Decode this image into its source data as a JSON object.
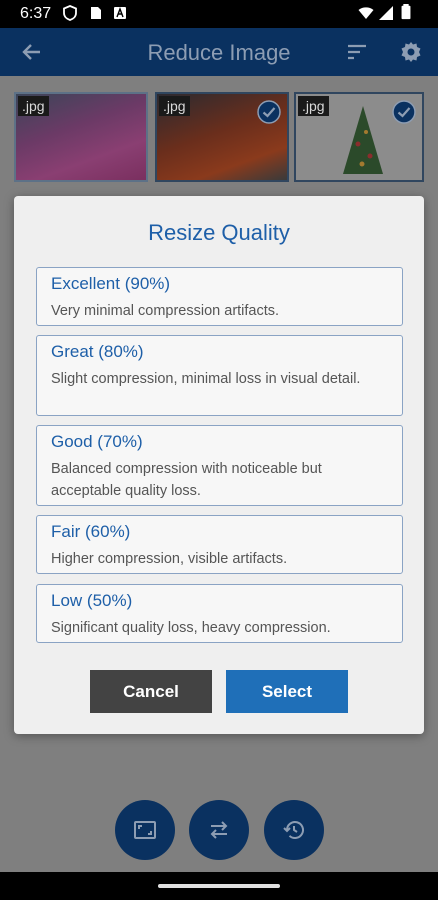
{
  "status_bar": {
    "time": "6:37"
  },
  "app_bar": {
    "title": "Reduce Image",
    "icons": [
      "back-arrow-icon",
      "sort-icon",
      "settings-icon"
    ]
  },
  "thumbnails": [
    {
      "ext": ".jpg",
      "selected": false
    },
    {
      "ext": ".jpg",
      "selected": true
    },
    {
      "ext": ".jpg",
      "selected": true
    }
  ],
  "dialog": {
    "title": "Resize Quality",
    "options": [
      {
        "label": "Excellent (90%)",
        "description": "Very minimal compression artifacts."
      },
      {
        "label": "Great (80%)",
        "description": "Slight compression, minimal loss in visual detail."
      },
      {
        "label": "Good (70%)",
        "description": "Balanced compression with noticeable but acceptable quality loss."
      },
      {
        "label": "Fair (60%)",
        "description": "Higher compression, visible artifacts."
      },
      {
        "label": "Low (50%)",
        "description": "Significant quality loss, heavy compression."
      }
    ],
    "cancel_label": "Cancel",
    "select_label": "Select"
  },
  "bottom_actions": [
    "resize-icon",
    "swap-icon",
    "history-icon"
  ],
  "colors": {
    "app_bar": "#0a3160",
    "accent": "#1e5fa8",
    "select_button": "#1f6fb8",
    "cancel_button": "#434343"
  }
}
